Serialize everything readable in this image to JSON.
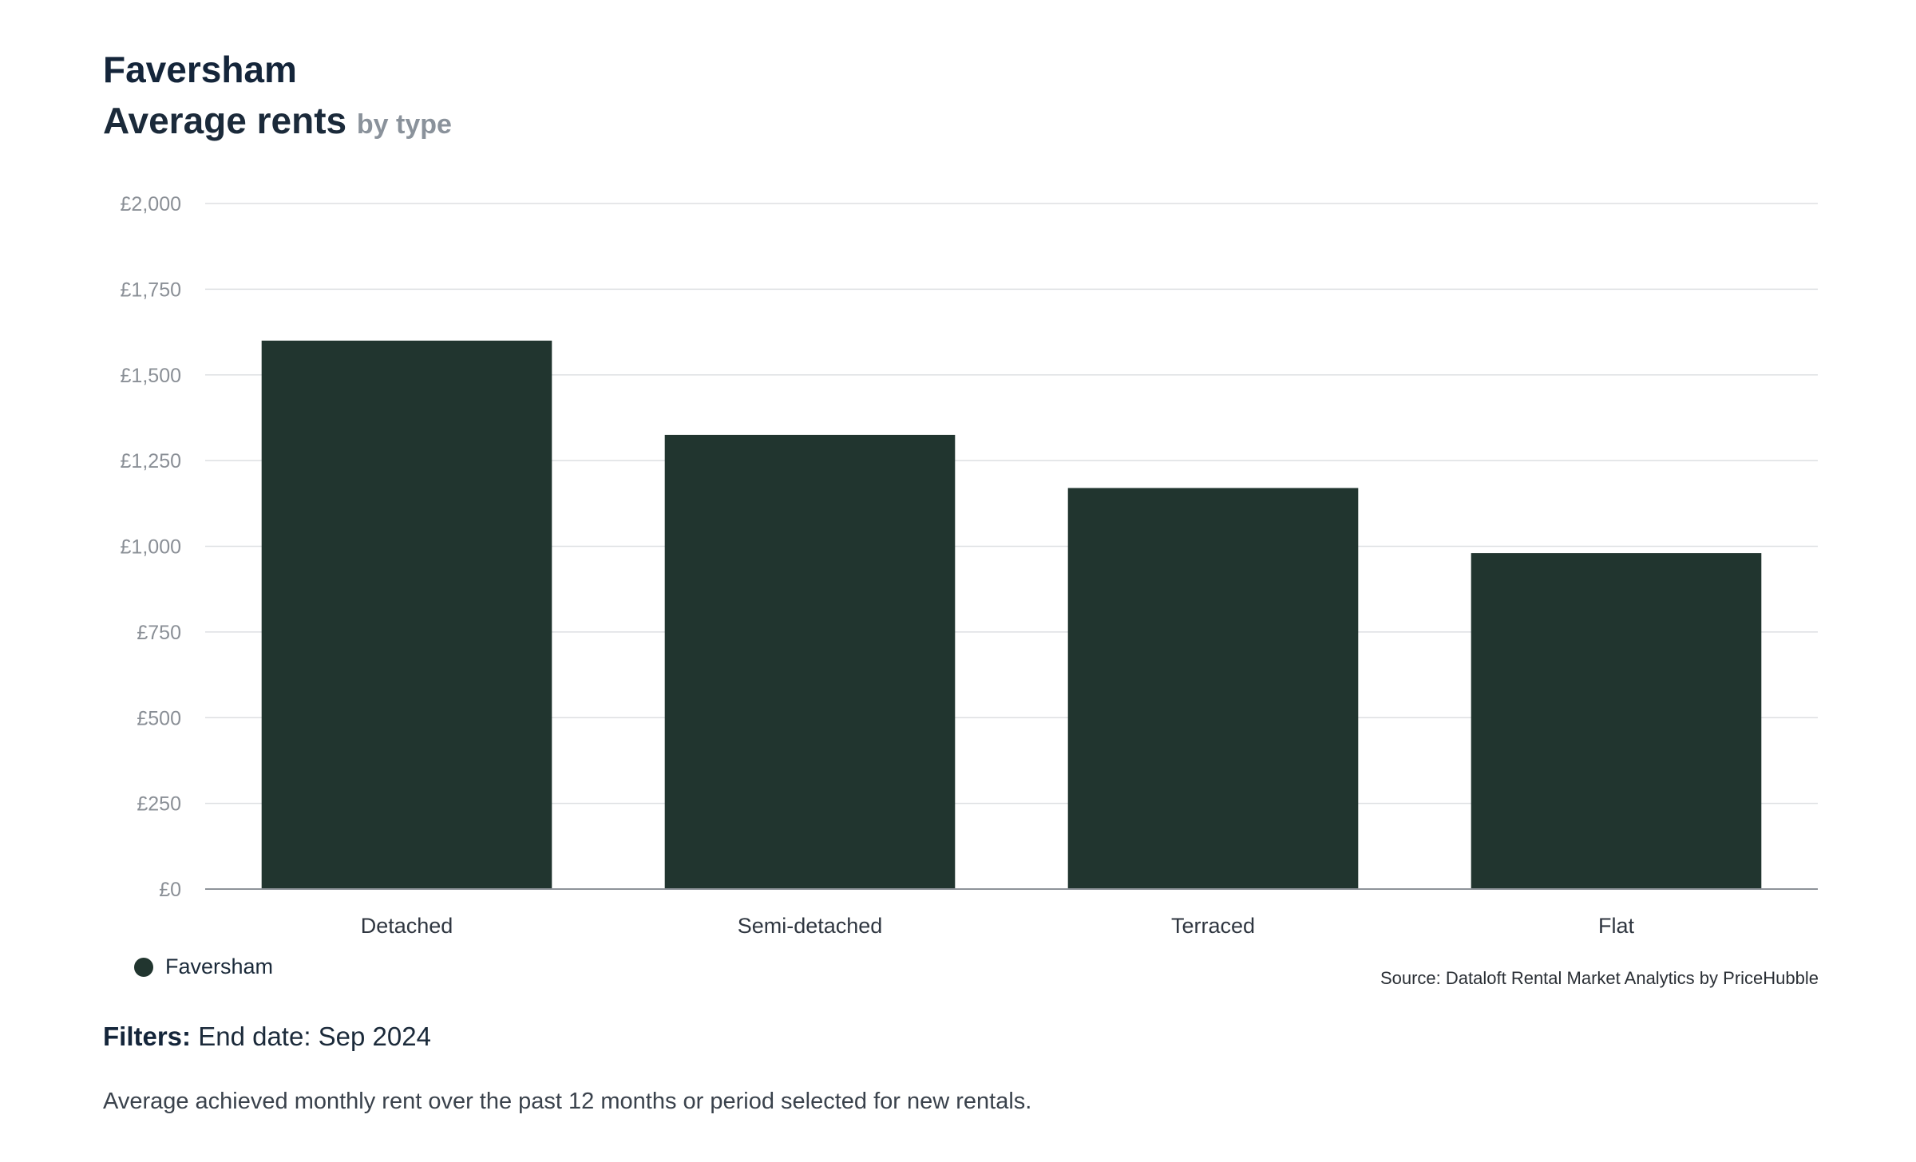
{
  "header": {
    "title": "Faversham",
    "subtitle_main": "Average rents",
    "subtitle_suffix": "by type"
  },
  "colors": {
    "bar": "#21352f",
    "gridline": "#dddfe2",
    "baseline": "#8e9399",
    "tick_text": "#8a8f96",
    "category_text": "#2f3640"
  },
  "chart_data": {
    "type": "bar",
    "title": "Faversham",
    "subtitle": "Average rents by type",
    "categories": [
      "Detached",
      "Semi-detached",
      "Terraced",
      "Flat"
    ],
    "series": [
      {
        "name": "Faversham",
        "values": [
          1600,
          1325,
          1170,
          980
        ]
      }
    ],
    "ylim": [
      0,
      2000
    ],
    "yticks": [
      0,
      250,
      500,
      750,
      1000,
      1250,
      1500,
      1750,
      2000
    ],
    "ytick_labels": [
      "£0",
      "£250",
      "£500",
      "£750",
      "£1,000",
      "£1,250",
      "£1,500",
      "£1,750",
      "£2,000"
    ],
    "xlabel": "",
    "ylabel": "",
    "grid": true,
    "legend_position": "bottom-left"
  },
  "legend": {
    "label": "Faversham"
  },
  "source": "Source: Dataloft Rental Market Analytics by PriceHubble",
  "filters": {
    "label": "Filters:",
    "value": "End date: Sep 2024"
  },
  "note": "Average achieved monthly rent over the past 12 months or period selected for new rentals."
}
